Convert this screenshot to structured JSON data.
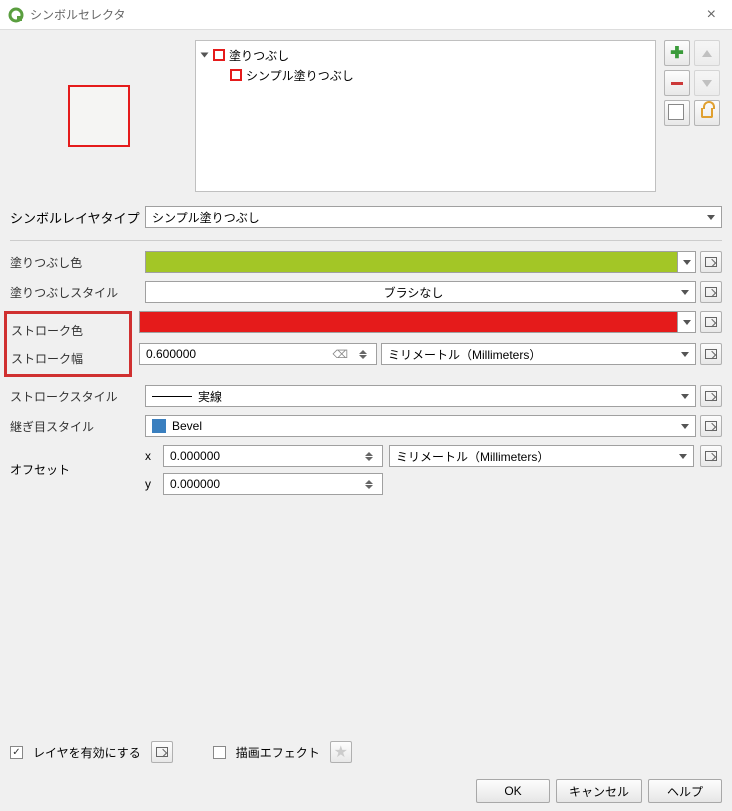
{
  "window": {
    "title": "シンボルセレクタ"
  },
  "tree": {
    "root": "塗りつぶし",
    "child": "シンプル塗りつぶし"
  },
  "layer_type": {
    "label": "シンボルレイヤタイプ",
    "value": "シンプル塗りつぶし"
  },
  "fill_color": {
    "label": "塗りつぶし色",
    "hex": "#a3c626"
  },
  "fill_style": {
    "label": "塗りつぶしスタイル",
    "value": "ブラシなし"
  },
  "stroke_color": {
    "label": "ストローク色",
    "hex": "#e51b1b"
  },
  "stroke_width": {
    "label": "ストローク幅",
    "value": "0.600000",
    "unit": "ミリメートル（Millimeters）"
  },
  "stroke_style": {
    "label": "ストロークスタイル",
    "value": "実線"
  },
  "join_style": {
    "label": "継ぎ目スタイル",
    "value": "Bevel"
  },
  "offset": {
    "label": "オフセット",
    "x_label": "x",
    "x_value": "0.000000",
    "y_label": "y",
    "y_value": "0.000000",
    "unit": "ミリメートル（Millimeters）"
  },
  "footer": {
    "enable_layer": "レイヤを有効にする",
    "draw_effect": "描画エフェクト"
  },
  "buttons": {
    "ok": "OK",
    "cancel": "キャンセル",
    "help": "ヘルプ"
  }
}
